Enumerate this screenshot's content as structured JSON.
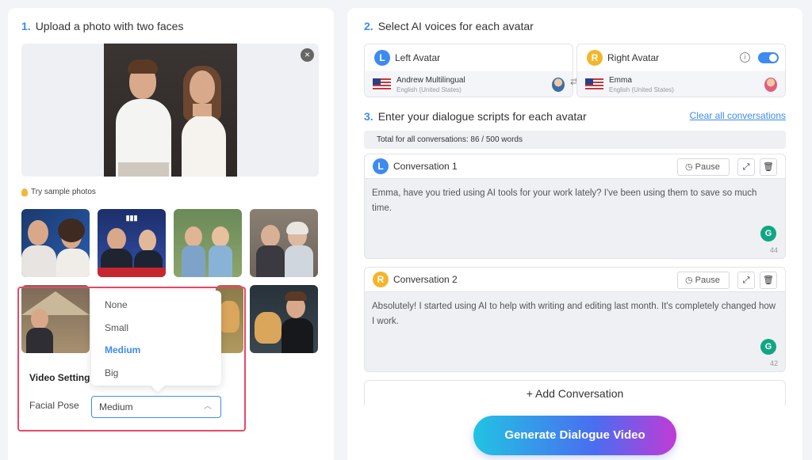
{
  "left": {
    "step1": {
      "num": "1.",
      "title": "Upload a photo with two faces"
    },
    "close_symbol": "×",
    "sample_hint": "Try sample photos",
    "dropdown_options": [
      "None",
      "Small",
      "Medium",
      "Big"
    ],
    "dropdown_selected": "Medium",
    "video_settings_title": "Video Setting",
    "facial_pose_label": "Facial Pose",
    "facial_pose_value": "Medium"
  },
  "right": {
    "step2": {
      "num": "2.",
      "title": "Select AI voices for each avatar"
    },
    "left_avatar": {
      "badge": "L",
      "label": "Left Avatar",
      "voice": "Andrew Multilingual",
      "lang": "English (United States)"
    },
    "right_avatar": {
      "badge": "R",
      "label": "Right Avatar",
      "voice": "Emma",
      "lang": "English (United States)",
      "toggle_on": true
    },
    "swap_symbol": "⇄",
    "step3": {
      "num": "3.",
      "title": "Enter your dialogue scripts for each avatar"
    },
    "clear_all": "Clear all conversations",
    "total": "Total for all conversations: 86 / 500 words",
    "conversations": [
      {
        "badge": "L",
        "title": "Conversation 1",
        "pause": "Pause",
        "text": "Emma, have you tried using AI tools for your work lately? I've been using them to save so much time.",
        "count": "44"
      },
      {
        "badge": "R",
        "title": "Conversation 2",
        "pause": "Pause",
        "text": "Absolutely! I started using AI to help with writing and editing last month. It's completely changed how I work.",
        "count": "42"
      }
    ],
    "add_conversation": "+ Add Conversation",
    "generate": "Generate Dialogue Video"
  },
  "colors": {
    "accent": "#3d8bf0",
    "highlight": "#e64a67",
    "left_badge": "#3d8bf0",
    "right_badge": "#f4b52a"
  }
}
